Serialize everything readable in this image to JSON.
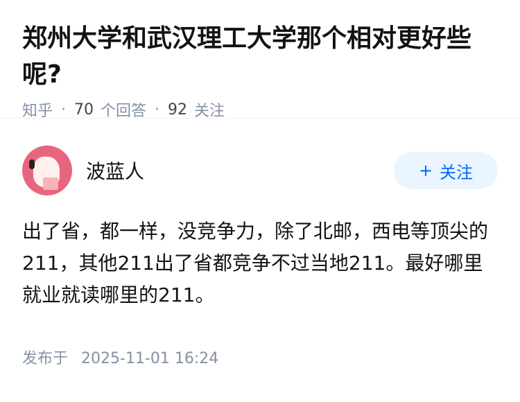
{
  "question": {
    "title": "郑州大学和武汉理工大学那个相对更好些呢?",
    "source": "知乎",
    "answers_count": "70",
    "answers_label": "个回答",
    "followers_count": "92",
    "followers_label": "关注"
  },
  "answer": {
    "author": "波蓝人",
    "follow_label": "关注",
    "content": "出了省，都一样，没竞争力，除了北邮，西电等顶尖的211，其他211出了省都竞争不过当地211。最好哪里就业就读哪里的211。",
    "published_label": "发布于",
    "published_date": "2025-11-01 16:24"
  },
  "colors": {
    "accent": "#0066ff",
    "follow_bg": "#ebf5ff",
    "meta_gray": "#8590a6",
    "avatar_bg": "#e8657f"
  },
  "icons": {
    "follow": "plus-icon",
    "avatar": "avatar-illustration"
  }
}
